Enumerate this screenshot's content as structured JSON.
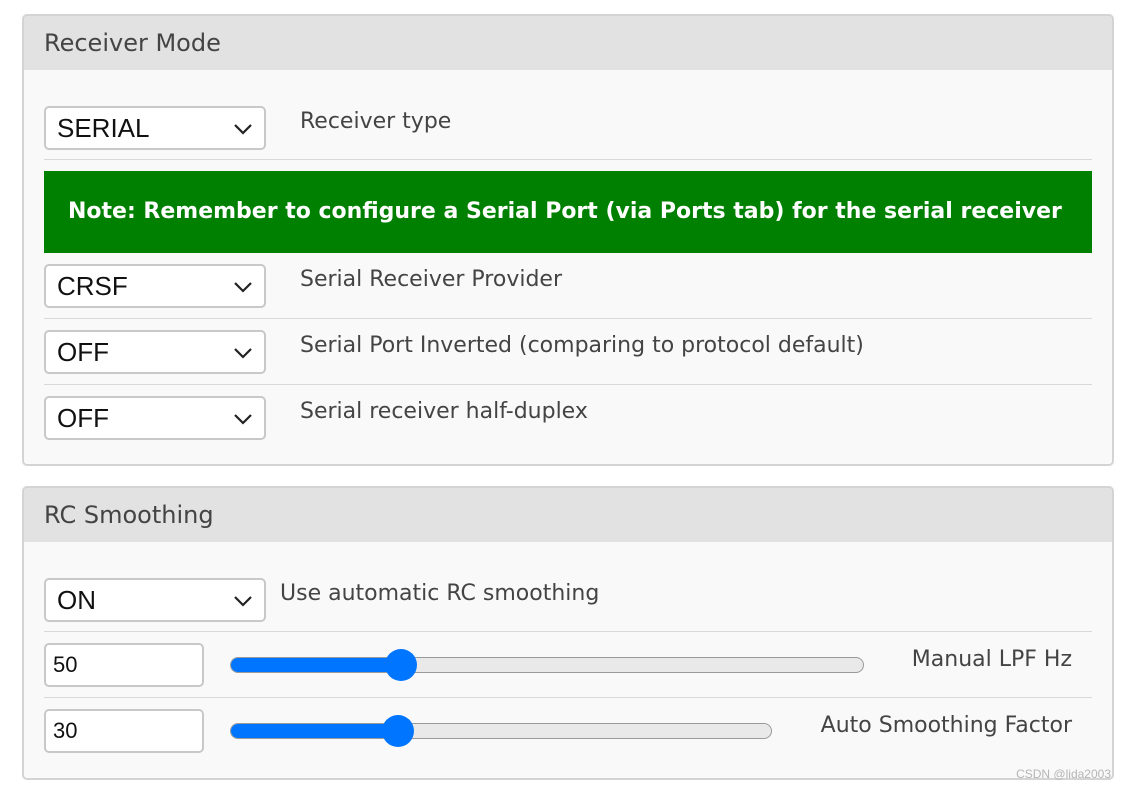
{
  "receiver_mode": {
    "title": "Receiver Mode",
    "receiver_type": {
      "value": "SERIAL",
      "label": "Receiver type"
    },
    "note": "Note: Remember to configure a Serial Port (via Ports tab) for the serial receiver",
    "provider": {
      "value": "CRSF",
      "label": "Serial Receiver Provider"
    },
    "inverted": {
      "value": "OFF",
      "label": "Serial Port Inverted (comparing to protocol default)"
    },
    "half_duplex": {
      "value": "OFF",
      "label": "Serial receiver half-duplex"
    }
  },
  "rc_smoothing": {
    "title": "RC Smoothing",
    "auto": {
      "value": "ON",
      "label": "Use automatic RC smoothing"
    },
    "manual_lpf": {
      "value": "50",
      "label": "Manual LPF Hz",
      "slider_fraction": 0.27
    },
    "auto_factor": {
      "value": "30",
      "label": "Auto Smoothing Factor",
      "slider_fraction": 0.31
    }
  },
  "watermark": "CSDN @lida2003",
  "colors": {
    "accent": "#0075ff",
    "note_bg": "#008000",
    "header_bg": "#e2e2e2"
  },
  "icons": {
    "dropdown": "chevron-down-icon"
  }
}
